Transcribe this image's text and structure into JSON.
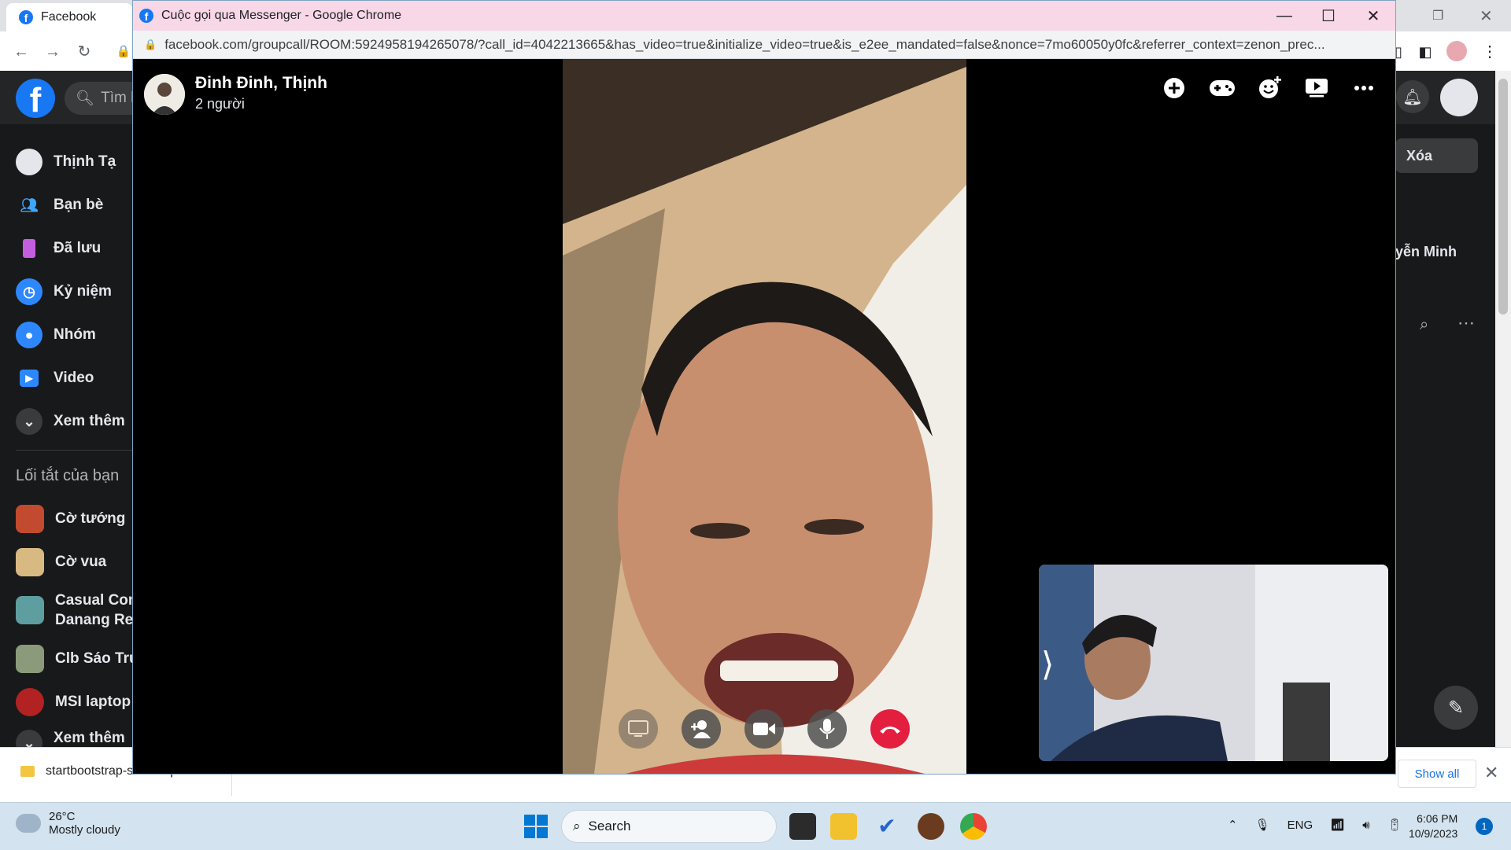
{
  "bg_browser": {
    "tab_title": "Facebook",
    "restore_icon": "restore-icon",
    "close_icon": "close-icon"
  },
  "facebook": {
    "search_placeholder": "Tìm k",
    "sidebar": [
      {
        "label": "Thịnh Tạ",
        "icon": "avatar"
      },
      {
        "label": "Bạn bè",
        "icon": "friends-icon"
      },
      {
        "label": "Đã lưu",
        "icon": "bookmark-icon"
      },
      {
        "label": "Kỷ niệm",
        "icon": "clock-icon"
      },
      {
        "label": "Nhóm",
        "icon": "groups-icon"
      },
      {
        "label": "Video",
        "icon": "video-icon"
      },
      {
        "label": "Xem thêm",
        "icon": "chevron-down-icon"
      }
    ],
    "shortcuts_title": "Lối tắt của bạn",
    "shortcuts": [
      {
        "label": "Cờ tướng"
      },
      {
        "label": "Cờ vua"
      },
      {
        "label": "Casual Com",
        "label2": "Danang Res"
      },
      {
        "label": "Clb Sáo Trúc"
      },
      {
        "label": "MSI laptop"
      },
      {
        "label": "Xem thêm"
      }
    ],
    "right_button": "Xóa",
    "right_name": "yễn Minh"
  },
  "call_window": {
    "title": "Cuộc gọi qua Messenger - Google Chrome",
    "url": "facebook.com/groupcall/ROOM:5924958194265078/?call_id=4042213665&has_video=true&initialize_video=true&is_e2ee_mandated=false&nonce=7mo60050y0fc&referrer_context=zenon_prec...",
    "call_name": "Đinh Đinh, Thịnh",
    "participants": "2 người",
    "header_icons": [
      "add-icon",
      "gamepad-icon",
      "effects-icon",
      "watch-together-icon",
      "more-icon"
    ],
    "controls": [
      "share-screen-icon",
      "add-person-icon",
      "camera-icon",
      "microphone-icon",
      "end-call-icon"
    ]
  },
  "downloads": {
    "file": "startbootstrap-sho....zip",
    "show_all": "Show all"
  },
  "taskbar": {
    "temp": "26°C",
    "weather": "Mostly cloudy",
    "search": "Search",
    "lang": "ENG",
    "time": "6:06 PM",
    "date": "10/9/2023",
    "notifications": "1"
  }
}
